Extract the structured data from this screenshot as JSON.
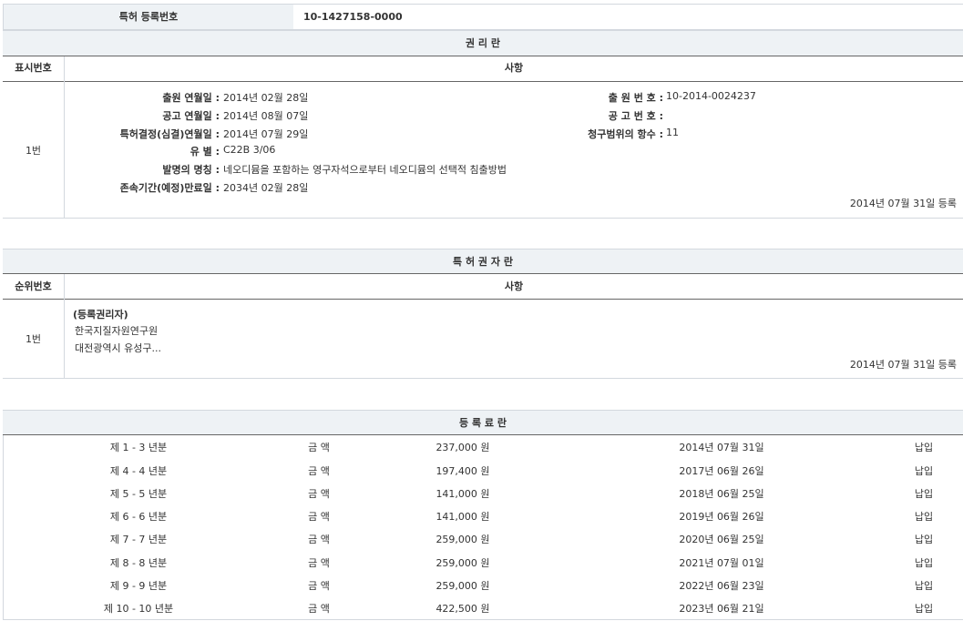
{
  "patent": {
    "reg_no_label": "특허 등록번호",
    "reg_no_value": "10-1427158-0000"
  },
  "rights": {
    "section_title": "권 리 란",
    "col_no": "표시번호",
    "col_matter": "사항",
    "row_no": "1번",
    "left_fields": [
      {
        "label": "출원 연월일 :",
        "value": "2014년 02월 28일"
      },
      {
        "label": "공고 연월일 :",
        "value": "2014년 08월 07일"
      },
      {
        "label": "특허결정(심결)연월일 :",
        "value": "2014년 07월 29일"
      },
      {
        "label": "유 별 :",
        "value": "C22B 3/06"
      },
      {
        "label": "발명의 명칭 :",
        "value": "네오디뮴을 포함하는 영구자석으로부터 네오디뮴의 선택적 침출방법"
      },
      {
        "label": "존속기간(예정)만료일 :",
        "value": "2034년 02월 28일"
      }
    ],
    "right_fields": [
      {
        "label": "출 원 번 호 :",
        "value": "10-2014-0024237"
      },
      {
        "label": "공 고 번 호 :",
        "value": ""
      },
      {
        "label": "청구범위의 항수 :",
        "value": "11"
      }
    ],
    "registered": "2014년 07월 31일 등록"
  },
  "holder": {
    "section_title": "특 허 권 자 란",
    "col_no": "순위번호",
    "col_matter": "사항",
    "row_no": "1번",
    "type": "(등록권리자)",
    "name": "한국지질자원연구원",
    "address": "대전광역시 유성구...",
    "registered": "2014년 07월 31일 등록"
  },
  "fees": {
    "section_title": "등 록 료 란",
    "rows": [
      {
        "period": "제 1 - 3 년분",
        "label": "금 액",
        "amount": "237,000 원",
        "date": "2014년 07월 31일",
        "status": "납입"
      },
      {
        "period": "제 4 - 4 년분",
        "label": "금 액",
        "amount": "197,400 원",
        "date": "2017년 06월 26일",
        "status": "납입"
      },
      {
        "period": "제 5 - 5 년분",
        "label": "금 액",
        "amount": "141,000 원",
        "date": "2018년 06월 25일",
        "status": "납입"
      },
      {
        "period": "제 6 - 6 년분",
        "label": "금 액",
        "amount": "141,000 원",
        "date": "2019년 06월 26일",
        "status": "납입"
      },
      {
        "period": "제 7 - 7 년분",
        "label": "금 액",
        "amount": "259,000 원",
        "date": "2020년 06월 25일",
        "status": "납입"
      },
      {
        "period": "제 8 - 8 년분",
        "label": "금 액",
        "amount": "259,000 원",
        "date": "2021년 07월 01일",
        "status": "납입"
      },
      {
        "period": "제 9 - 9 년분",
        "label": "금 액",
        "amount": "259,000 원",
        "date": "2022년 06월 23일",
        "status": "납입"
      },
      {
        "period": "제 10 - 10 년분",
        "label": "금 액",
        "amount": "422,500 원",
        "date": "2023년 06월 21일",
        "status": "납입"
      }
    ]
  }
}
